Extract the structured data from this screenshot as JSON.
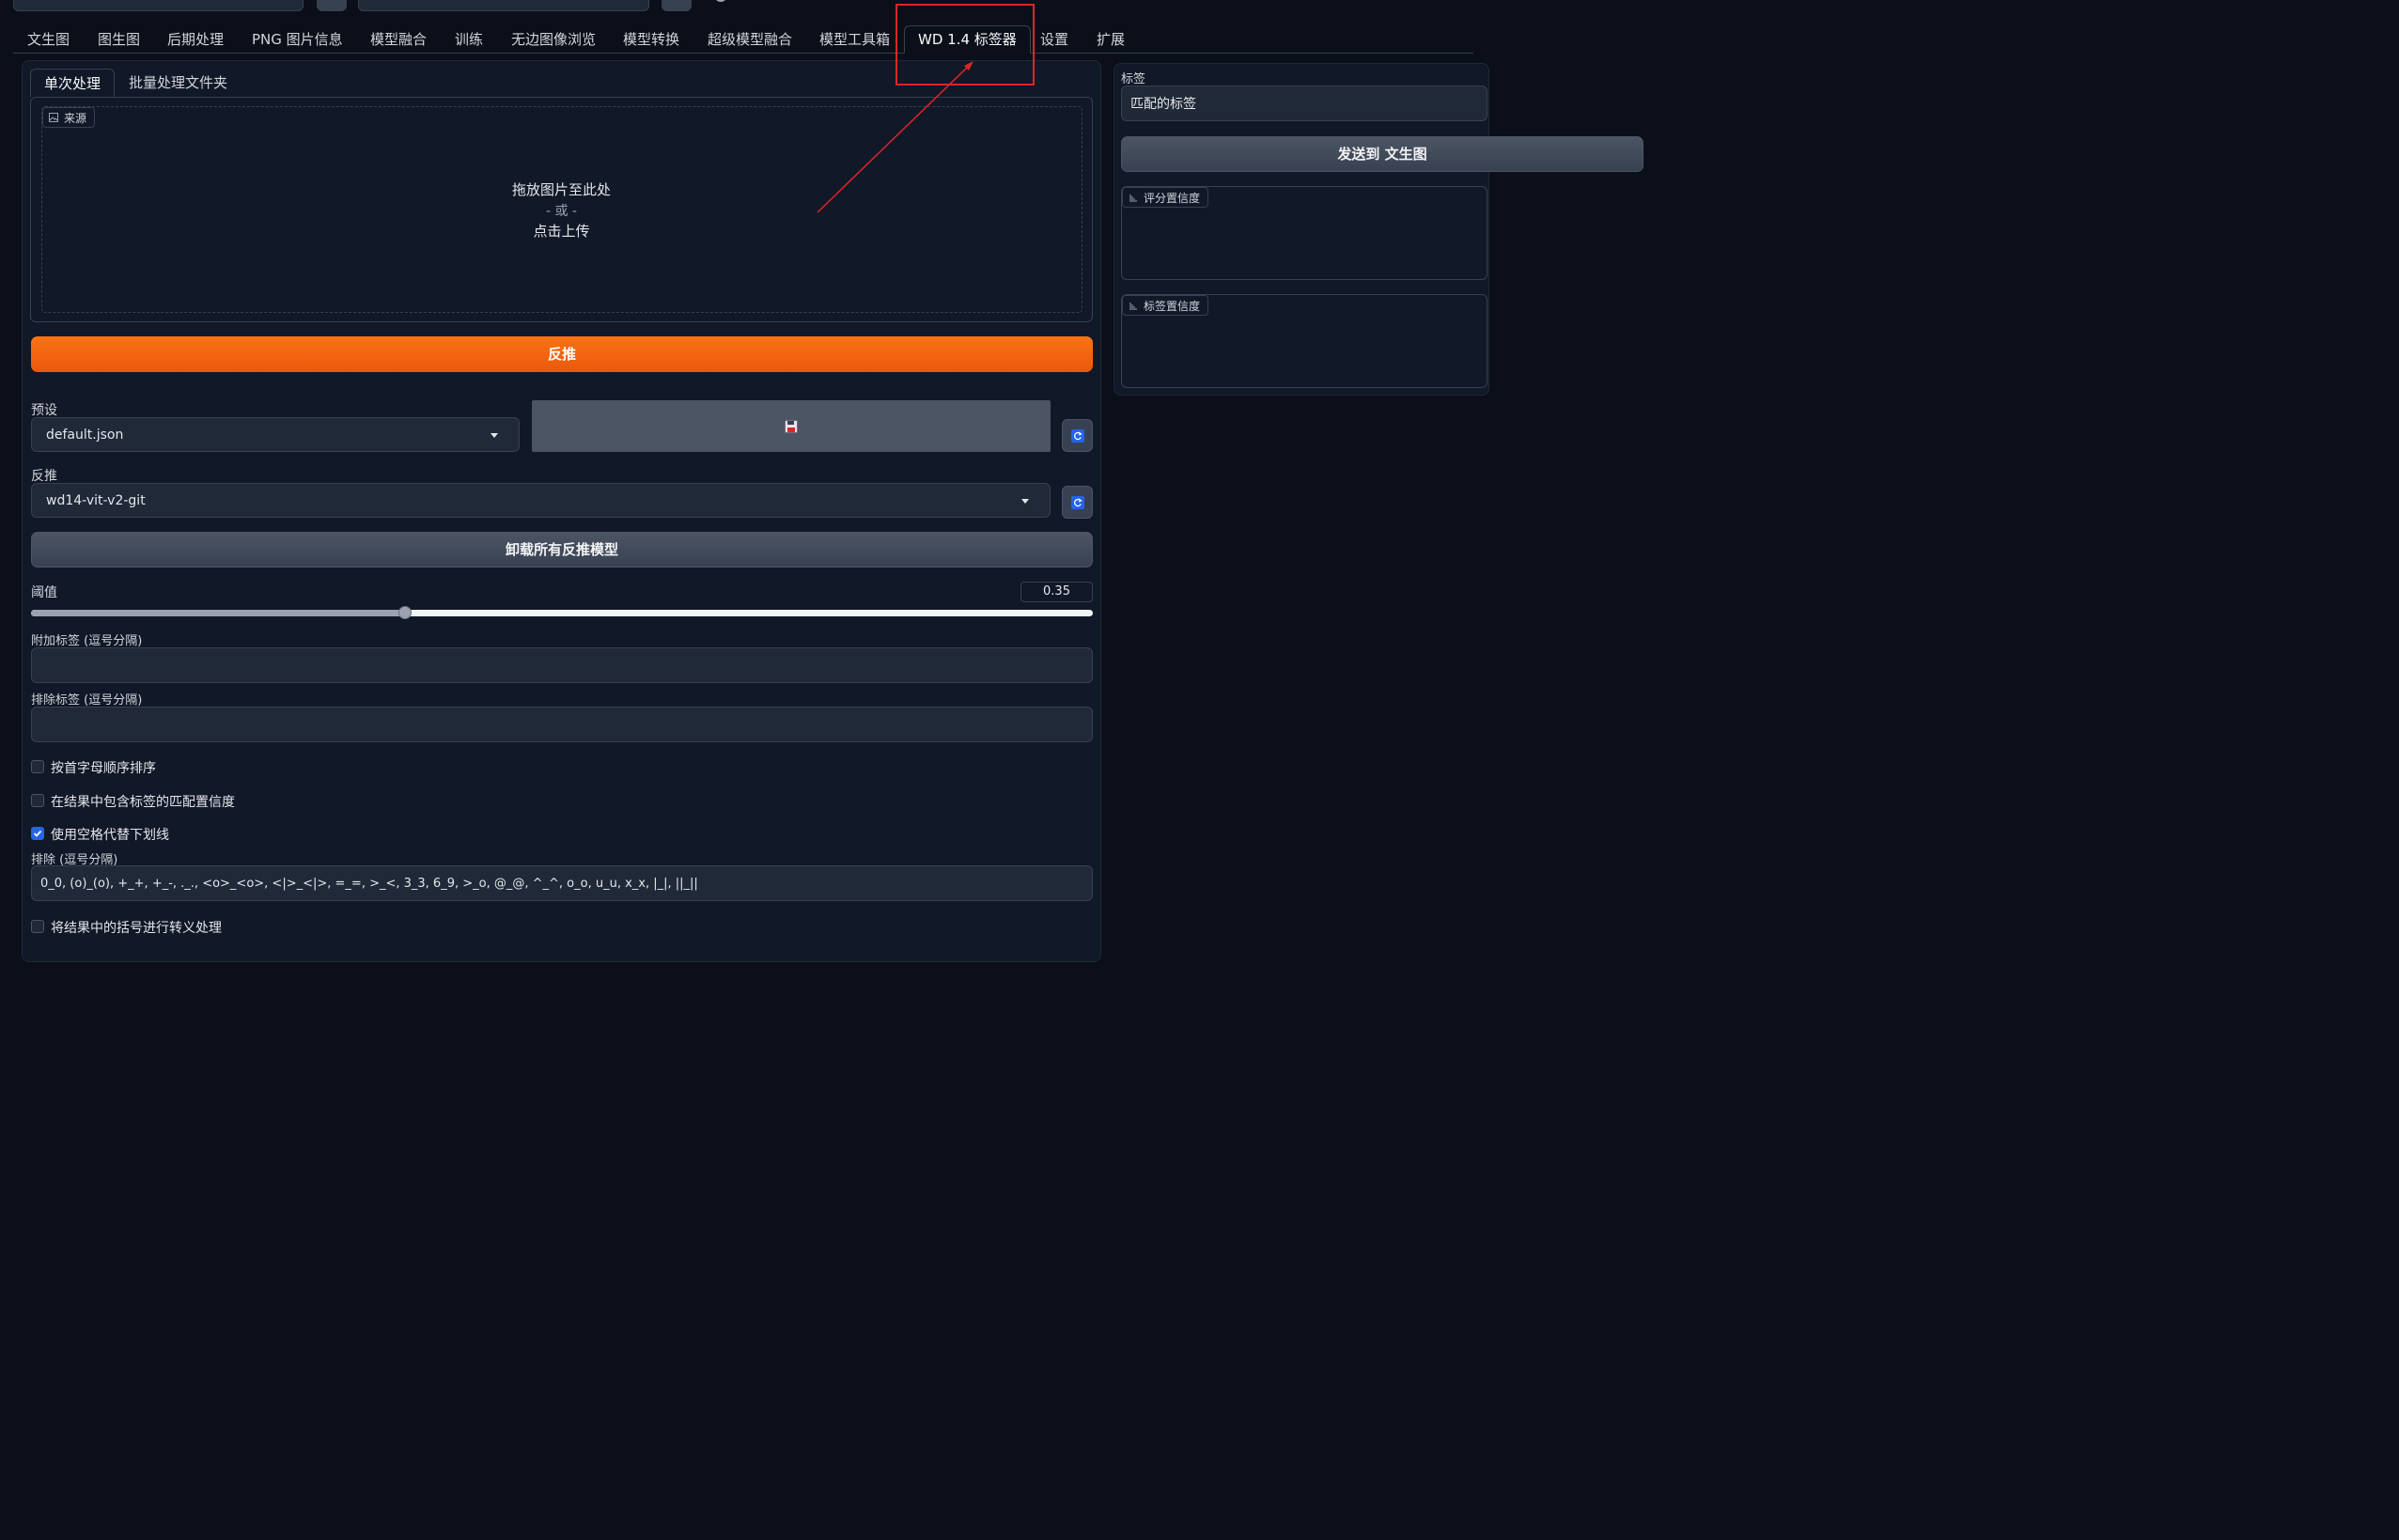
{
  "tabs": [
    {
      "label": "文生图"
    },
    {
      "label": "图生图"
    },
    {
      "label": "后期处理"
    },
    {
      "label": "PNG 图片信息"
    },
    {
      "label": "模型融合"
    },
    {
      "label": "训练"
    },
    {
      "label": "无边图像浏览"
    },
    {
      "label": "模型转换"
    },
    {
      "label": "超级模型融合"
    },
    {
      "label": "模型工具箱"
    },
    {
      "label": "WD 1.4 标签器"
    },
    {
      "label": "设置"
    },
    {
      "label": "扩展"
    }
  ],
  "subtabs": [
    {
      "label": "单次处理"
    },
    {
      "label": "批量处理文件夹"
    }
  ],
  "upload": {
    "source_label": "来源",
    "drop_text": "拖放图片至此处",
    "or_text": "- 或 -",
    "click_text": "点击上传"
  },
  "interrogate_button": "反推",
  "preset": {
    "label": "预设",
    "value": "default.json"
  },
  "interrogator": {
    "label": "反推",
    "value": "wd14-vit-v2-git"
  },
  "unload_button": "卸载所有反推模型",
  "threshold": {
    "label": "阈值",
    "value": "0.35",
    "fraction": 0.35
  },
  "additional_tags": {
    "label": "附加标签 (逗号分隔)",
    "value": ""
  },
  "exclude_tags": {
    "label": "排除标签 (逗号分隔)",
    "value": ""
  },
  "checkboxes": [
    {
      "label": "按首字母顺序排序",
      "checked": false
    },
    {
      "label": "在结果中包含标签的匹配置信度",
      "checked": false
    },
    {
      "label": "使用空格代替下划线",
      "checked": true
    }
  ],
  "exclude": {
    "label": "排除 (逗号分隔)",
    "value": "0_0, (o)_(o), +_+, +_-, ._., <o>_<o>, <|>_<|>, =_=, >_<, 3_3, 6_9, >_o, @_@, ^_^, o_o, u_u, x_x, |_|, ||_||"
  },
  "escape_checkbox": {
    "label": "将结果中的括号进行转义处理",
    "checked": false
  },
  "right": {
    "tags_label": "标签",
    "tags_value": "匹配的标签",
    "send_button": "发送到 文生图",
    "rating_label": "评分置信度",
    "tag_conf_label": "标签置信度"
  },
  "colors": {
    "accent_orange": "#f97316",
    "annotation_red": "#dc2626",
    "checkbox_blue": "#2563eb"
  }
}
